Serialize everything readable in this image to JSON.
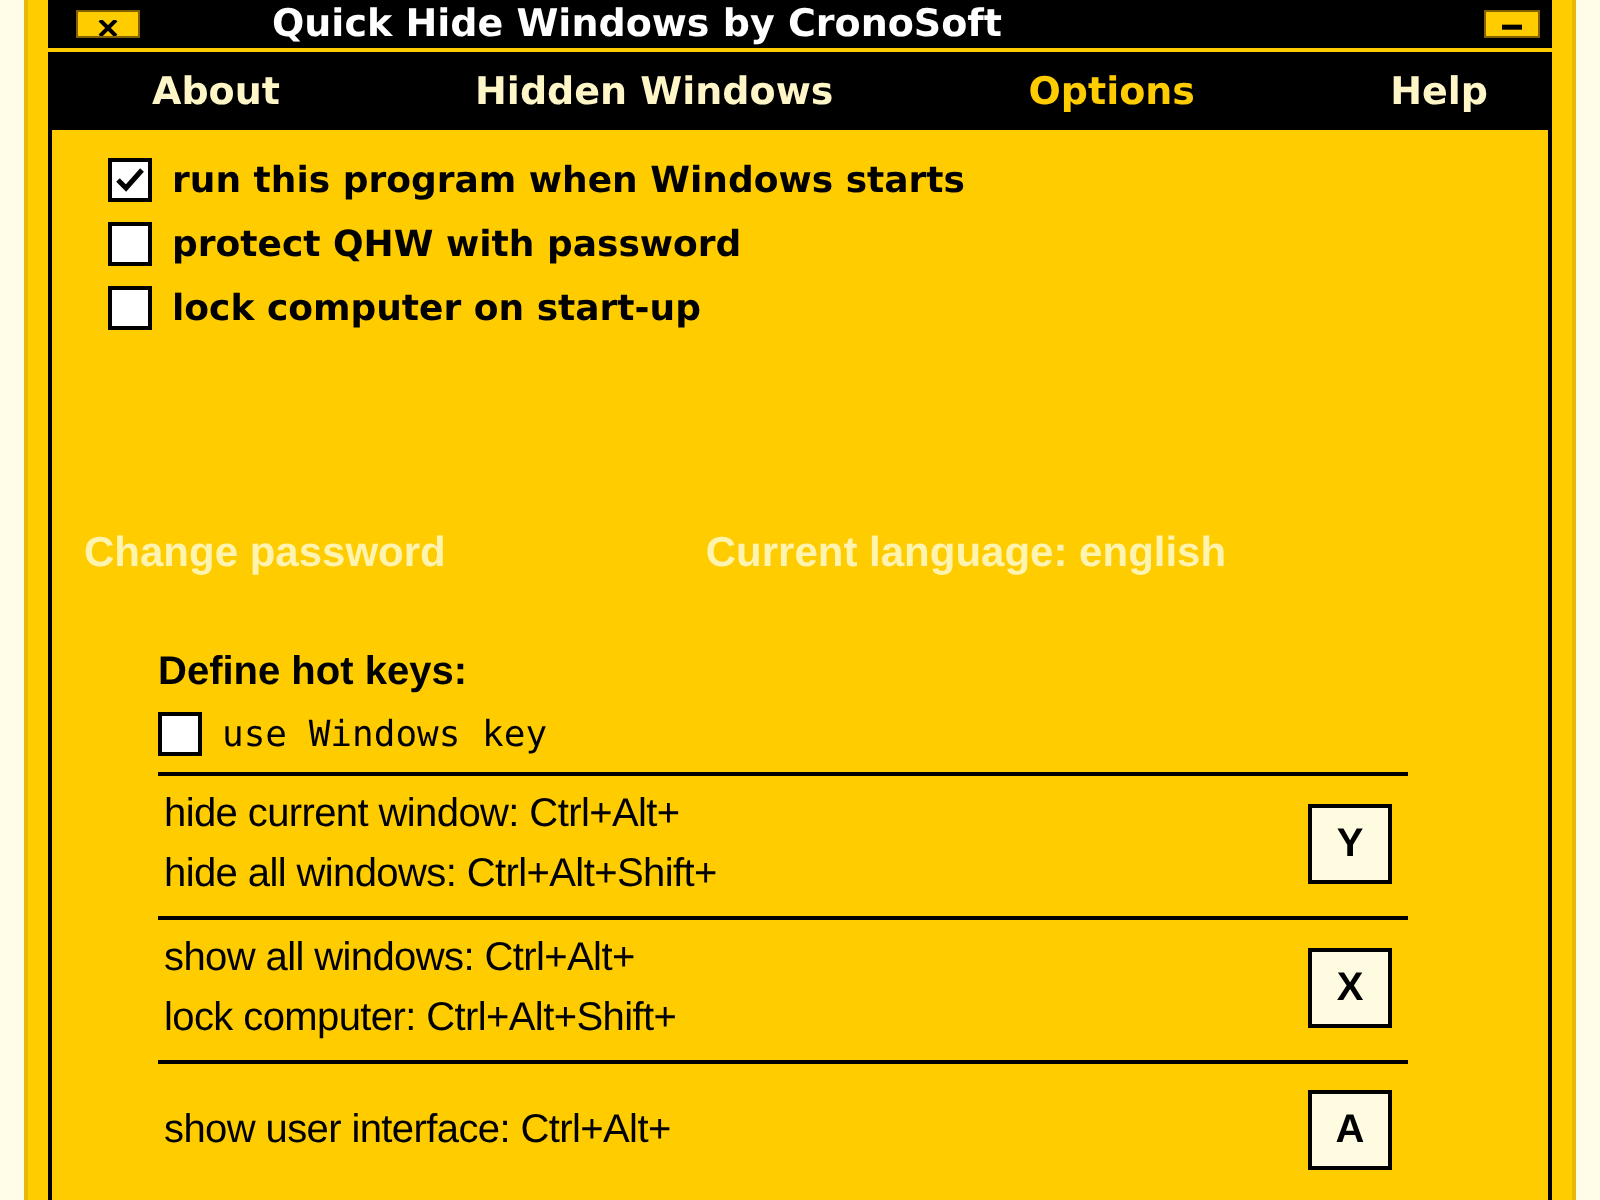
{
  "window": {
    "title": "Quick Hide Windows by CronoSoft"
  },
  "menu": [
    {
      "label": "About",
      "selected": false
    },
    {
      "label": "Hidden Windows",
      "selected": false
    },
    {
      "label": "Options",
      "selected": true
    },
    {
      "label": "Help",
      "selected": false
    }
  ],
  "options": [
    {
      "label": "run this program when Windows starts",
      "checked": true
    },
    {
      "label": "protect QHW with password",
      "checked": false
    },
    {
      "label": "lock computer on start-up",
      "checked": false
    }
  ],
  "links": {
    "change_password": "Change password",
    "language": "Current language: english"
  },
  "hotkeys": {
    "title": "Define hot keys:",
    "use_windows_key": {
      "label": "use Windows key",
      "checked": false
    },
    "groups": [
      {
        "lines": [
          "hide current window: Ctrl+Alt+",
          "hide all windows: Ctrl+Alt+Shift+"
        ],
        "key": "Y"
      },
      {
        "lines": [
          "show all windows: Ctrl+Alt+",
          "lock computer: Ctrl+Alt+Shift+"
        ],
        "key": "X"
      },
      {
        "lines": [
          "show user interface: Ctrl+Alt+"
        ],
        "key": "A"
      }
    ]
  }
}
